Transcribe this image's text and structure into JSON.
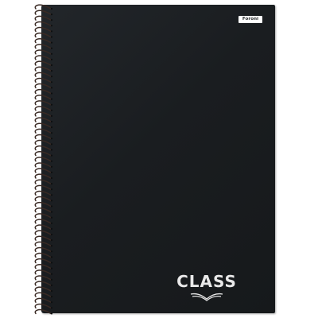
{
  "cover": {
    "brand_logo_text": "Foroni",
    "title": "CLASS"
  },
  "colors": {
    "cover": "#1b1e20",
    "spiral": "#3a2a24",
    "title": "#e9e9e9",
    "logo_background": "#ffffff"
  },
  "icons": {
    "brand_mark": "open-book-icon",
    "binding": "spiral-binding"
  }
}
